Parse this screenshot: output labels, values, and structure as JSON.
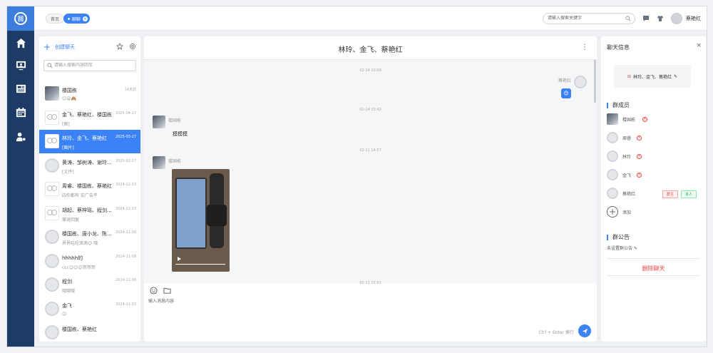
{
  "topbar": {
    "tabs": [
      {
        "label": "首页"
      },
      {
        "label": "聊聊"
      }
    ],
    "search_placeholder": "请输入搜索关键字",
    "user_name": "蔡艳红"
  },
  "list": {
    "create_label": "创建聊天",
    "search_placeholder": "请输入搜索内容回车",
    "conversations": [
      {
        "name": "楼国栋",
        "time": "14天前",
        "preview": "😊😃🙈",
        "avatar": "photo"
      },
      {
        "name": "金飞、蔡艳红、楼国栋",
        "time": "2025-04-17",
        "preview": "[图]",
        "avatar": "group"
      },
      {
        "name": "林玲、金飞、蔡艳红",
        "time": "2025-03-27",
        "preview": "[图片]",
        "avatar": "group",
        "active": true
      },
      {
        "name": "黄涛、邹树涛、谢玲...",
        "time": "2025-02-27",
        "preview": "[文件]",
        "avatar": "blank"
      },
      {
        "name": "周睿、楼国栋、蔡艳红",
        "time": "2024-12-23",
        "preview": "四你都有 宏广告平",
        "avatar": "group"
      },
      {
        "name": "胡起、蔡梓瑶、程剑...",
        "time": "2024-12-23",
        "preview": "撤退回复",
        "avatar": "group"
      },
      {
        "name": "楼国栋、唐小龙、陈...",
        "time": "2024-11-08",
        "preview": "界界吃吃滴滴😊 哦",
        "avatar": "blank"
      },
      {
        "name": "hhhhh的",
        "time": "2024-11-08",
        "preview": "ccc😊😊😊哥哥哥",
        "avatar": "blank"
      },
      {
        "name": "程剑",
        "time": "2024-11-08",
        "preview": "哦哦哦",
        "avatar": "blank"
      },
      {
        "name": "金飞",
        "time": "2024-11-03",
        "preview": "😊",
        "avatar": "blank"
      },
      {
        "name": "楼国栋、蔡艳红",
        "time": "",
        "preview": "",
        "avatar": "blank"
      }
    ]
  },
  "chat": {
    "title": "林玲、金飞、蔡艳红",
    "timestamps": [
      "02-14 10:09",
      "02-14 15:42",
      "02-21 14:57",
      "02-21 15:01"
    ],
    "messages": [
      {
        "sender": "蔡艳红",
        "content": "😊"
      },
      {
        "sender": "楼国栋",
        "content": "模模模"
      },
      {
        "sender": "楼国栋",
        "content": ""
      }
    ],
    "input_placeholder": "输入消息内容",
    "send_hint": "Ctrl + Enter 换行"
  },
  "info": {
    "title": "聊天信息",
    "group_name": "林玲、金飞、蔡艳红",
    "members_title": "群成员",
    "members": [
      {
        "name": "楼国栋",
        "avatar": "photo",
        "removable": true
      },
      {
        "name": "周睿",
        "avatar": "blank",
        "removable": true
      },
      {
        "name": "林玲",
        "avatar": "blank",
        "removable": true
      },
      {
        "name": "金飞",
        "avatar": "blank",
        "removable": true
      },
      {
        "name": "蔡艳红",
        "avatar": "blank",
        "removable": false,
        "badges": [
          "群主",
          "本人"
        ]
      }
    ],
    "add_label": "添加",
    "notice_title": "群公告",
    "notice_text": "未设置群公告",
    "delete_label": "删除聊天"
  },
  "colors": {
    "accent": "#3b82f6",
    "nav": "#1c3b66",
    "danger": "#ef4444"
  }
}
